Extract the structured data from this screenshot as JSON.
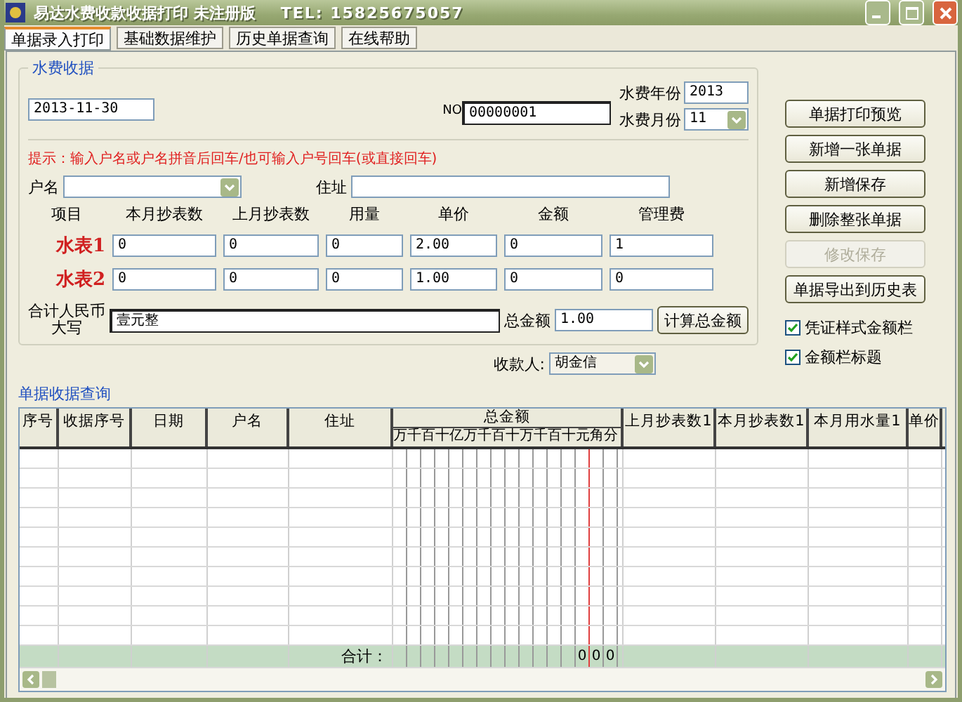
{
  "window": {
    "title": "易达水费收款收据打印  未注册版",
    "phone": "TEL: 15825675057"
  },
  "tabs": [
    {
      "label": "单据录入打印",
      "selected": true
    },
    {
      "label": "基础数据维护",
      "selected": false
    },
    {
      "label": "历史单据查询",
      "selected": false
    },
    {
      "label": "在线帮助",
      "selected": false
    }
  ],
  "receipt": {
    "title": "水费收据",
    "date": "2013-11-30",
    "no_label": "NO",
    "no_value": "00000001",
    "year_label": "水费年份",
    "year": "2013",
    "month_label": "水费月份",
    "month": "11",
    "hint": "提示：输入户名或户名拼音后回车/也可输入户号回车(或直接回车)",
    "name_label": "户名",
    "address_label": "住址",
    "columns": [
      "项目",
      "本月抄表数",
      "上月抄表数",
      "用量",
      "单价",
      "金额",
      "管理费"
    ],
    "meters": [
      {
        "label": "水表1",
        "values": [
          "0",
          "0",
          "0",
          "2.00",
          "0",
          "1"
        ]
      },
      {
        "label": "水表2",
        "values": [
          "0",
          "0",
          "0",
          "1.00",
          "0",
          "0"
        ]
      }
    ],
    "total_cn_label": [
      "合计人民币",
      "大写"
    ],
    "total_cn": "壹元整",
    "total_label": "总金额",
    "total": "1.00",
    "calc_button": "计算总金额"
  },
  "payee": {
    "label": "收款人:",
    "value": "胡金信"
  },
  "buttons": [
    {
      "label": "单据打印预览",
      "disabled": false
    },
    {
      "label": "新增一张单据",
      "disabled": false
    },
    {
      "label": "新增保存",
      "disabled": false
    },
    {
      "label": "删除整张单据",
      "disabled": false
    },
    {
      "label": "修改保存",
      "disabled": true
    },
    {
      "label": "单据导出到历史表",
      "disabled": false
    }
  ],
  "checkboxes": [
    {
      "label": "凭证样式金额栏",
      "checked": true
    },
    {
      "label": "金额栏标题",
      "checked": true
    }
  ],
  "query": {
    "title": "单据收据查询",
    "columns": [
      {
        "label": "序号",
        "kind": "text"
      },
      {
        "label": "收据序号",
        "kind": "text"
      },
      {
        "label": "日期",
        "kind": "text"
      },
      {
        "label": "户名",
        "kind": "text"
      },
      {
        "label": "住址",
        "kind": "text"
      },
      {
        "label": "总金额",
        "kind": "amount",
        "digits": [
          "万",
          "千",
          "百",
          "十",
          "亿",
          "万",
          "千",
          "百",
          "十",
          "万",
          "千",
          "百",
          "十",
          "元",
          "角",
          "分"
        ]
      },
      {
        "label": "上月抄表数1",
        "kind": "text"
      },
      {
        "label": "本月抄表数1",
        "kind": "text"
      },
      {
        "label": "本月用水量1",
        "kind": "text"
      },
      {
        "label": "单价",
        "kind": "text"
      }
    ],
    "total_label": "合计：",
    "total_digits": [
      "0",
      "0",
      "0"
    ]
  }
}
